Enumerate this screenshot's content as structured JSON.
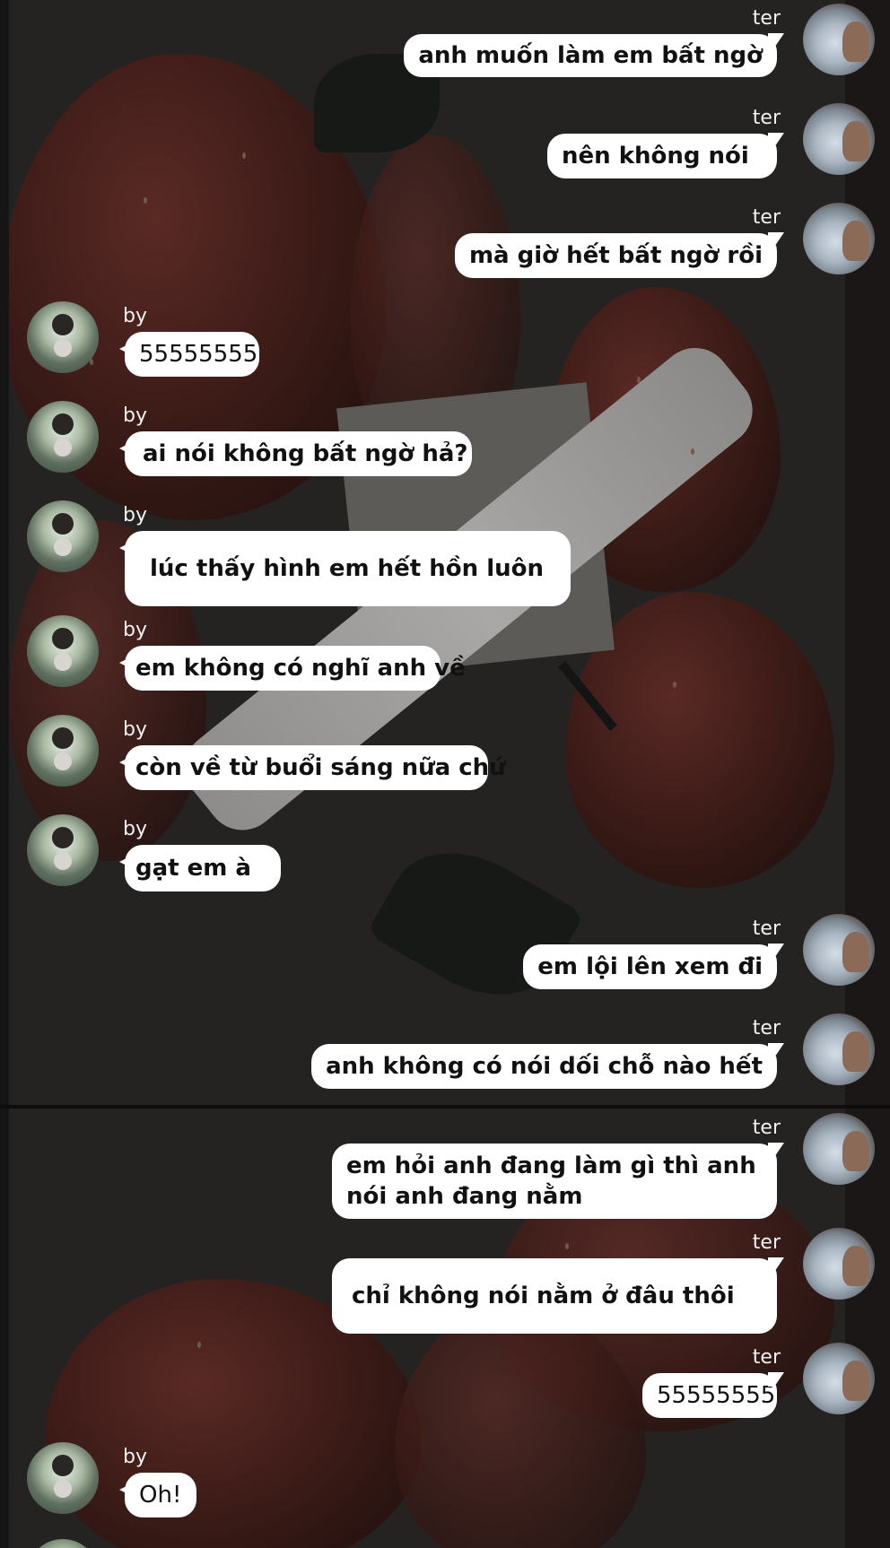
{
  "conversation": {
    "participants": {
      "ter": {
        "display_name": "ter",
        "side": "right",
        "avatar": "ter-avatar"
      },
      "by": {
        "display_name": "by",
        "side": "left",
        "avatar": "by-avatar"
      }
    },
    "messages": [
      {
        "sender": "ter",
        "name": "ter",
        "text": "anh muốn làm em bất ngờ"
      },
      {
        "sender": "ter",
        "name": "ter",
        "text": "nên không nói"
      },
      {
        "sender": "ter",
        "name": "ter",
        "text": "mà giờ hết bất ngờ rồi"
      },
      {
        "sender": "by",
        "name": "by",
        "text": "55555555"
      },
      {
        "sender": "by",
        "name": "by",
        "text": "ai nói không bất ngờ hả?"
      },
      {
        "sender": "by",
        "name": "by",
        "text": "lúc thấy hình em hết hồn luôn"
      },
      {
        "sender": "by",
        "name": "by",
        "text": "em không có nghĩ anh về"
      },
      {
        "sender": "by",
        "name": "by",
        "text": "còn về từ buổi sáng nữa chứ"
      },
      {
        "sender": "by",
        "name": "by",
        "text": "gạt em à"
      },
      {
        "sender": "ter",
        "name": "ter",
        "text": "em lội lên xem đi"
      },
      {
        "sender": "ter",
        "name": "ter",
        "text": "anh không có nói dối chỗ nào hết"
      },
      {
        "sender": "ter",
        "name": "ter",
        "text": "em hỏi anh đang làm gì thì anh nói anh đang nằm"
      },
      {
        "sender": "ter",
        "name": "ter",
        "text": "chỉ không nói nằm ở đâu thôi"
      },
      {
        "sender": "ter",
        "name": "ter",
        "text": "55555555"
      },
      {
        "sender": "by",
        "name": "by",
        "text": "Oh!"
      }
    ]
  },
  "colors": {
    "bubble": "#ffffff",
    "bubble_text": "#111111",
    "name_text": "#f2f2f2",
    "background": "#242322"
  }
}
